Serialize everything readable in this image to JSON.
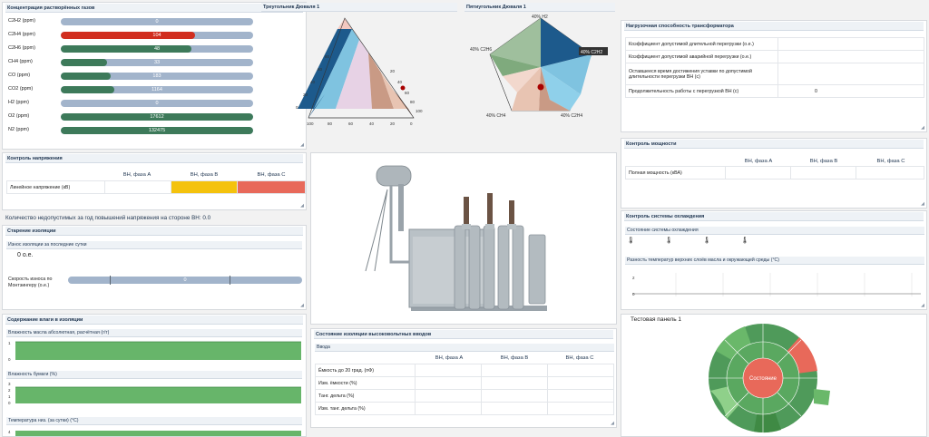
{
  "gases": {
    "title": "Концентрация растворённых газов",
    "rows": [
      {
        "label": "C2H2 (ppm)",
        "value": "0",
        "fill_pct": 0,
        "color": "#a2b4cb"
      },
      {
        "label": "C2H4 (ppm)",
        "value": "104",
        "fill_pct": 70,
        "color": "#d12e1f"
      },
      {
        "label": "C2H6 (ppm)",
        "value": "48",
        "fill_pct": 68,
        "color": "#3d7a5a"
      },
      {
        "label": "CH4 (ppm)",
        "value": "33",
        "fill_pct": 24,
        "color": "#3d7a5a"
      },
      {
        "label": "CO (ppm)",
        "value": "183",
        "fill_pct": 26,
        "color": "#3d7a5a"
      },
      {
        "label": "CO2 (ppm)",
        "value": "1164",
        "fill_pct": 28,
        "color": "#3d7a5a"
      },
      {
        "label": "H2 (ppm)",
        "value": "0",
        "fill_pct": 0,
        "color": "#a2b4cb"
      },
      {
        "label": "O2 (ppm)",
        "value": "17612",
        "fill_pct": 100,
        "color": "#3d7a5a"
      },
      {
        "label": "N2 (ppm)",
        "value": "132475",
        "fill_pct": 100,
        "color": "#3d7a5a"
      }
    ]
  },
  "triangle": {
    "title": "Треугольник Дюваля 1",
    "left_ticks": [
      "80",
      "60",
      "40",
      "20",
      "0"
    ],
    "right_ticks": [
      "20",
      "40",
      "60",
      "80",
      "100"
    ],
    "bottom_ticks": [
      "100",
      "80",
      "60",
      "40",
      "20",
      "0"
    ]
  },
  "pentagon": {
    "title": "Пятиугольник Дюваля 1",
    "labels": [
      "40% H2",
      "40% C2H6",
      "40% CH4",
      "40% C2H4",
      "40% C2H2"
    ]
  },
  "load": {
    "title": "Нагрузочная способность трансформатора",
    "rows": [
      {
        "label": "Коэффициент допустимой длительной перегрузки (о.е.)",
        "value": ""
      },
      {
        "label": "Коэффициент допустимой аварийной перегрузки (о.е.)",
        "value": ""
      },
      {
        "label": "Оставшееся время достижения уставки по допустимой длительности перегрузки ВН (с)",
        "value": ""
      },
      {
        "label": "Продолжительность работы с перегрузкой ВН (с)",
        "value": "0"
      }
    ]
  },
  "power": {
    "title": "Контроль мощности",
    "cols": [
      "ВН, фаза А",
      "ВН, фаза В",
      "ВН, фаза С"
    ],
    "row_label": "Полная мощность (кВА)"
  },
  "cooling": {
    "title": "Контроль системы охлаждения",
    "state_title": "Состояние системы охлаждения",
    "diff_title": "Разность температур верхних слоёв масла и окружающей среды (°C)",
    "ticks": [
      "2",
      "0"
    ]
  },
  "voltage": {
    "title": "Контроль напряжения",
    "cols": [
      "ВН, фаза А",
      "ВН, фаза В",
      "ВН, фаза С"
    ],
    "row_label": "Линейное напряжение (кВ)",
    "colors": {
      "b": "#f4c20d",
      "c": "#e8695a"
    },
    "count_text": "Количество недопустимых за год повышений напряжения на стороне ВН: 0.0"
  },
  "aging": {
    "title": "Старение изоляции",
    "wear_title": "Износ изоляции за последние сутки",
    "wear_value": "0 о.е.",
    "speed_label_1": "Скорость износа по",
    "speed_label_2": "Монтзингеру (о.е.)",
    "speed_value": "0"
  },
  "moisture": {
    "title": "Содержание влаги в изоляции",
    "oil_title": "Влажность масла абсолютная, расчётная (г/т)",
    "paper_title": "Влажность бумаги (%)",
    "temp_title": "Температура низ. (за сутки) (°C)",
    "oil_ticks": [
      "1",
      "0"
    ],
    "paper_ticks": [
      "3",
      "2",
      "1",
      "0"
    ],
    "temp_ticks": [
      "4"
    ]
  },
  "bushings": {
    "title": "Состояние изоляции высоковольтных вводов",
    "sub_title": "Ввода",
    "cols": [
      "ВН, фаза А",
      "ВН, фаза В",
      "ВН, фаза С"
    ],
    "rows": [
      "Ёмкость до 20 град. (пФ)",
      "Изм. ёмкости (%)",
      "Танг. дельта (%)",
      "Изм. танг. дельта (%)"
    ]
  },
  "test_panel": {
    "title": "Тестовая панель 1",
    "center_label": "Состояние"
  }
}
